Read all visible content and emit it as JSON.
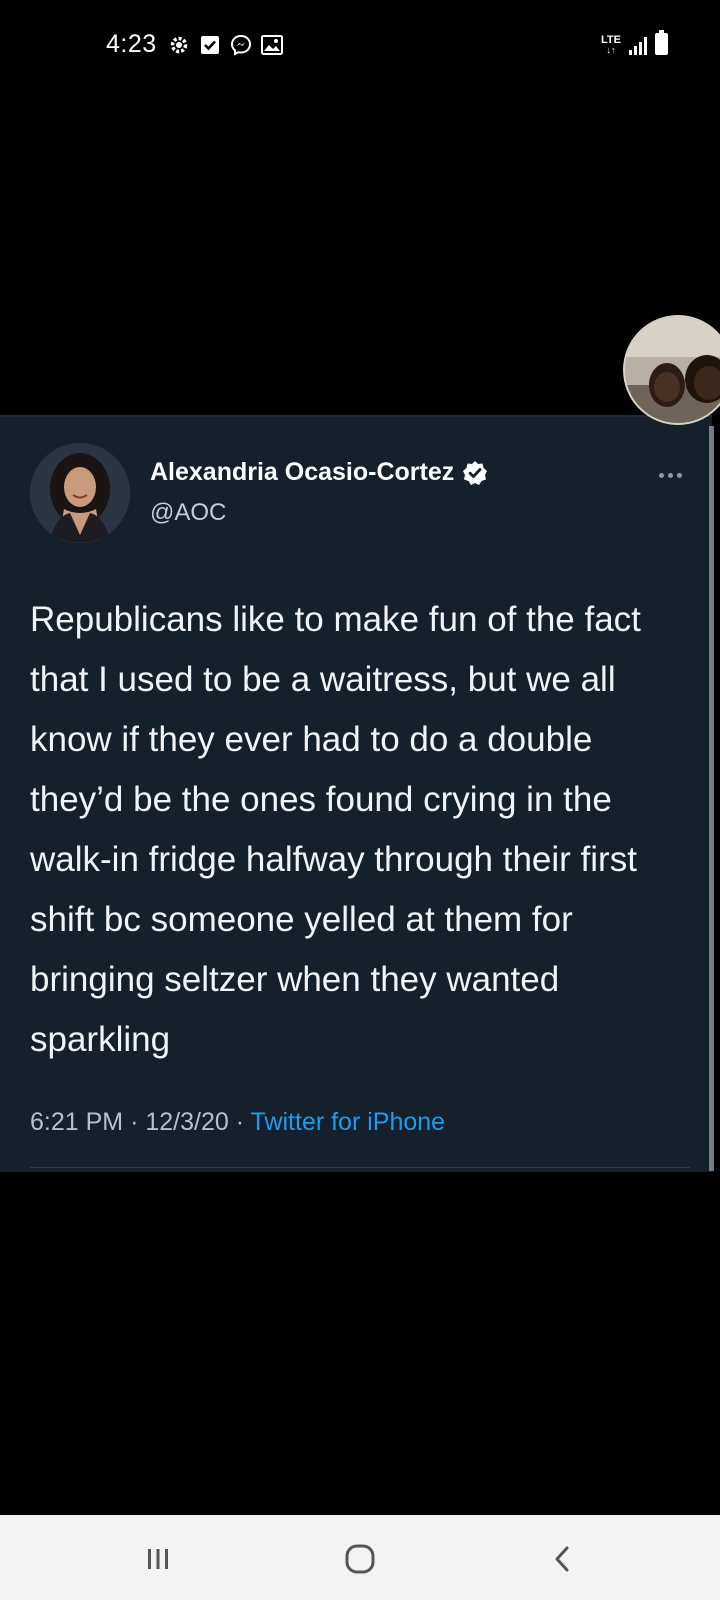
{
  "status_bar": {
    "time": "4:23",
    "left_icons": [
      "settings-icon",
      "checkbox-icon",
      "messenger-icon",
      "gallery-icon"
    ],
    "network": "LTE",
    "right_icons": [
      "lte-icon",
      "signal-icon",
      "battery-icon"
    ]
  },
  "tweet": {
    "display_name": "Alexandria Ocasio-Cortez",
    "handle": "@AOC",
    "verified": true,
    "text": "Republicans like to make fun of the fact that I used to be a waitress, but we all know if they ever had to do a double they’d be the ones found crying in the walk-in fridge halfway through their first shift bc someone yelled at them for bringing seltzer when they wanted sparkling",
    "time": "6:21 PM",
    "separator": "·",
    "date": "12/3/20",
    "source": "Twitter for iPhone"
  },
  "colors": {
    "card_background": "#15202b",
    "link_blue": "#1d9bf0",
    "verified_fill": "#ffffff"
  },
  "nav_bar": {
    "buttons": [
      "recent-apps-icon",
      "home-icon",
      "back-icon"
    ]
  }
}
